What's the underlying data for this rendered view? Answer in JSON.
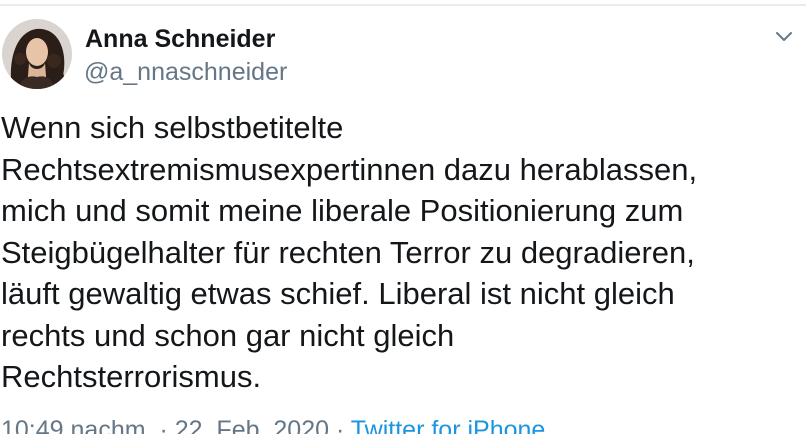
{
  "author": {
    "name": "Anna Schneider",
    "handle": "@a_nnaschneider"
  },
  "tweet": {
    "text": "Wenn sich selbstbetitelte\nRechtsextremismusexpertinnen dazu herablassen,\nmich und somit meine liberale Positionierung zum\nSteigbügelhalter für rechten Terror zu degradieren,\nläuft gewaltig etwas schief. Liberal ist nicht gleich\nrechts und schon gar nicht gleich\nRechtsterrorismus."
  },
  "meta": {
    "time": "10:49 nachm.",
    "separator1": " · ",
    "date": "22. Feb. 2020",
    "separator2": " · ",
    "source": "Twitter for iPhone"
  },
  "icons": {
    "menu": "chevron-down-icon",
    "avatar": "avatar"
  },
  "colors": {
    "text": "#14171a",
    "secondary": "#657786",
    "link": "#1b95e0"
  }
}
